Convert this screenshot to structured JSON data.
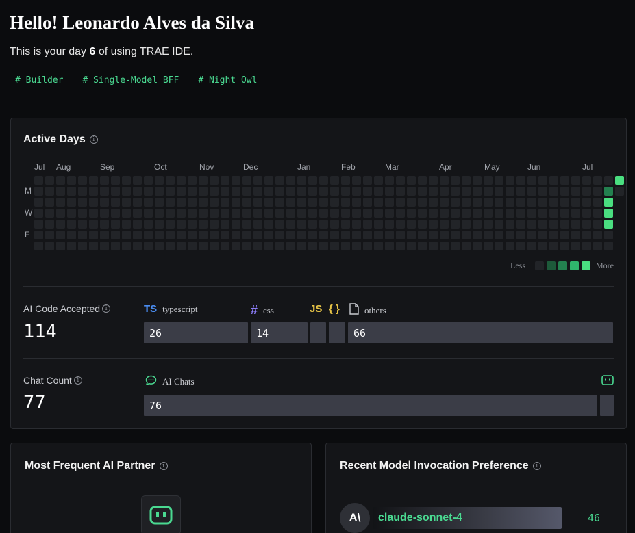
{
  "header": {
    "greeting": "Hello! Leonardo Alves da Silva",
    "subline_prefix": "This is your day ",
    "day_number": "6",
    "subline_suffix": " of using TRAE IDE.",
    "tags": [
      "# Builder",
      "# Single-Model BFF",
      "# Night Owl"
    ]
  },
  "active_days": {
    "title": "Active Days",
    "months": [
      "Jul",
      "Aug",
      "Sep",
      "Oct",
      "Nov",
      "Dec",
      "Jan",
      "Feb",
      "Mar",
      "Apr",
      "May",
      "Jun",
      "Jul"
    ],
    "day_labels": [
      "M",
      "W",
      "F"
    ],
    "legend_less": "Less",
    "legend_more": "More",
    "legend_colors": [
      "#222428",
      "#1d5a3a",
      "#23804f",
      "#2fb56d",
      "#4ade80"
    ],
    "active_cells": [
      {
        "week": 52,
        "day": 1,
        "level": 2
      },
      {
        "week": 52,
        "day": 2,
        "level": 4
      },
      {
        "week": 52,
        "day": 3,
        "level": 4
      },
      {
        "week": 52,
        "day": 4,
        "level": 4
      },
      {
        "week": 53,
        "day": 0,
        "level": 4
      }
    ]
  },
  "ai_code": {
    "label": "AI Code Accepted",
    "value": "114",
    "langs": [
      {
        "glyph": "TS",
        "name": "typescript",
        "color": "#4a8cf0"
      },
      {
        "glyph": "#",
        "name": "css",
        "color": "#8b7cf6"
      },
      {
        "glyph": "JS",
        "name": "",
        "color": "#e8c547"
      },
      {
        "glyph": "{ }",
        "name": "",
        "color": "#e8c547"
      },
      {
        "glyph": "file-icon",
        "name": "others",
        "color": "#c9cbd0"
      }
    ],
    "bars": [
      "26",
      "14",
      "",
      "",
      "66"
    ]
  },
  "chat": {
    "label": "Chat Count",
    "value": "77",
    "ai_chats_label": "AI Chats",
    "bars": [
      "76",
      ""
    ]
  },
  "partner": {
    "title": "Most Frequent AI Partner"
  },
  "model_pref": {
    "title": "Recent Model Invocation Preference",
    "models": [
      {
        "avatar": "A\\",
        "name": "claude-sonnet-4",
        "count": "46"
      }
    ]
  },
  "colors": {
    "accent_green": "#4ad991",
    "bar_gray": "#3b3d47",
    "card_bg": "#141518"
  }
}
